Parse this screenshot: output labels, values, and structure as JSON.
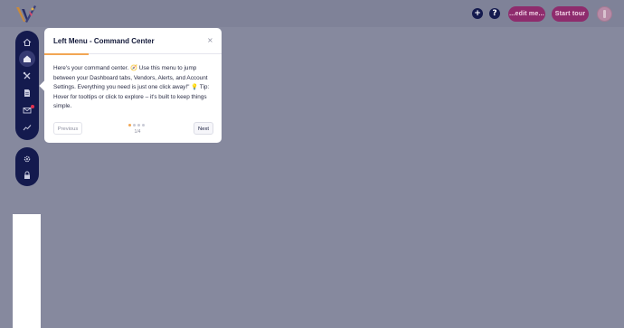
{
  "header": {
    "add_icon_glyph": "+",
    "help_icon_glyph": "?",
    "edit_button_label": "...edit me...",
    "start_tour_label": "Start tour"
  },
  "side_nav": {
    "items": [
      {
        "icon": "home-icon"
      },
      {
        "icon": "dashboard-icon",
        "active": true
      },
      {
        "icon": "tools-icon"
      },
      {
        "icon": "document-icon"
      },
      {
        "icon": "mail-icon",
        "badge": true
      },
      {
        "icon": "chart-icon"
      }
    ],
    "bottom_items": [
      {
        "icon": "gear-icon"
      },
      {
        "icon": "lock-icon"
      }
    ]
  },
  "tour": {
    "title": "Left Menu - Command Center",
    "close_glyph": "×",
    "body": "Here's your command center. 🧭 Use this menu to jump between your Dashboard tabs, Vendors, Alerts, and Account Settings. Everything you need is just one click away!\" 💡 Tip: Hover for tooltips or click to explore – it's built to keep things simple.",
    "previous_label": "Previous",
    "next_label": "Next",
    "step_text": "1/4",
    "total_steps": 4,
    "current_step": 1
  },
  "colors": {
    "overlay": "#86899e",
    "nav_bg": "#141a4e",
    "accent_orange": "#f2a654",
    "button_magenta": "#8e2c6d"
  }
}
